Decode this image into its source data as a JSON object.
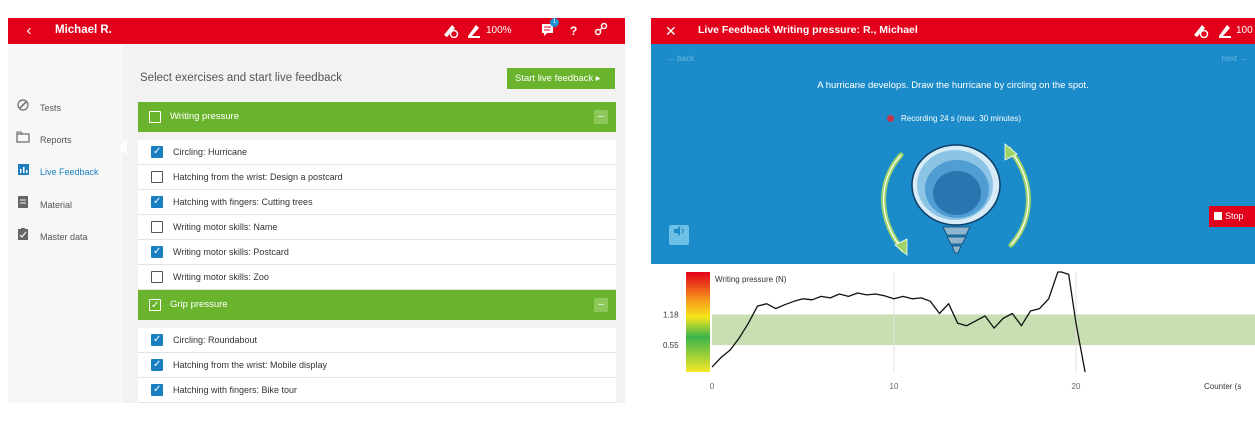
{
  "panel_a": {
    "header": {
      "back_icon": "‹",
      "user_name": "Michael R.",
      "pen_pct": "100%",
      "message_badge": "1",
      "help_label": "?"
    },
    "sidebar": {
      "items": [
        {
          "label": "Tests",
          "icon": "pencil-circle-icon"
        },
        {
          "label": "Reports",
          "icon": "folder-icon"
        },
        {
          "label": "Live Feedback",
          "icon": "bar-chart-icon"
        },
        {
          "label": "Material",
          "icon": "document-icon"
        },
        {
          "label": "Master data",
          "icon": "clipboard-icon"
        }
      ],
      "active_index": 2
    },
    "main": {
      "title": "Select exercises and start live feedback",
      "start_button": "Start live feedback ▸",
      "groups": [
        {
          "title": "Writing pressure",
          "checked": false,
          "collapse": "–",
          "exercises": [
            {
              "label": "Circling: Hurricane",
              "checked": true
            },
            {
              "label": "Hatching from the wrist: Design a postcard",
              "checked": false
            },
            {
              "label": "Hatching with fingers: Cutting trees",
              "checked": true
            },
            {
              "label": "Writing motor skills: Name",
              "checked": false
            },
            {
              "label": "Writing motor skills: Postcard",
              "checked": true
            },
            {
              "label": "Writing motor skills: Zoo",
              "checked": false
            }
          ]
        },
        {
          "title": "Grip pressure",
          "checked": true,
          "collapse": "–",
          "exercises": [
            {
              "label": "Circling: Roundabout",
              "checked": true
            },
            {
              "label": "Hatching from the wrist: Mobile display",
              "checked": true
            },
            {
              "label": "Hatching with fingers: Bike tour",
              "checked": true
            }
          ]
        }
      ]
    }
  },
  "panel_b": {
    "header": {
      "close_icon": "✕",
      "title": "Live Feedback Writing pressure: R., Michael",
      "pen_pct": "100"
    },
    "nav": {
      "back": "← back",
      "next": "next →"
    },
    "instruction": "A hurricane develops. Draw the hurricane by circling on the spot.",
    "recording": "Recording 24 s (max. 30 minutes)",
    "stop_label": "Stop",
    "colors": {
      "blue": "#1b8cc9",
      "red": "#e2001a",
      "green": "#6ab42d"
    }
  },
  "chart_data": {
    "type": "line",
    "ylabel": "Writing pressure (N)",
    "xlabel": "Counter (s",
    "x_ticks": [
      "0",
      "10",
      "20"
    ],
    "y_ticks": [
      "1.18",
      "0.55"
    ],
    "target_band": [
      0.55,
      1.18
    ],
    "xlim": [
      0,
      30
    ],
    "ylim": [
      0,
      2.05
    ],
    "series": [
      {
        "x": [
          0,
          0.5,
          1,
          1.5,
          2,
          2.5,
          3,
          3.5,
          4,
          4.5,
          5,
          5.5,
          6,
          6.5,
          7,
          7.5,
          8,
          8.5,
          9,
          9.5,
          10,
          10.5,
          11,
          11.5,
          12,
          12.5,
          13,
          13.5,
          14,
          14.5,
          15,
          15.5,
          16,
          16.5,
          17,
          17.5,
          18,
          18.5,
          19,
          19.2,
          19.6,
          20,
          20.5
        ],
        "y": [
          0.1,
          0.3,
          0.45,
          0.7,
          1.0,
          1.35,
          1.4,
          1.3,
          1.38,
          1.45,
          1.5,
          1.48,
          1.55,
          1.52,
          1.6,
          1.55,
          1.62,
          1.58,
          1.6,
          1.56,
          1.5,
          1.55,
          1.5,
          1.52,
          1.45,
          1.2,
          1.4,
          1.0,
          0.95,
          1.05,
          1.15,
          0.9,
          1.1,
          1.2,
          0.95,
          1.25,
          1.3,
          1.5,
          2.05,
          2.05,
          2.0,
          1.0,
          0.0
        ]
      }
    ]
  }
}
